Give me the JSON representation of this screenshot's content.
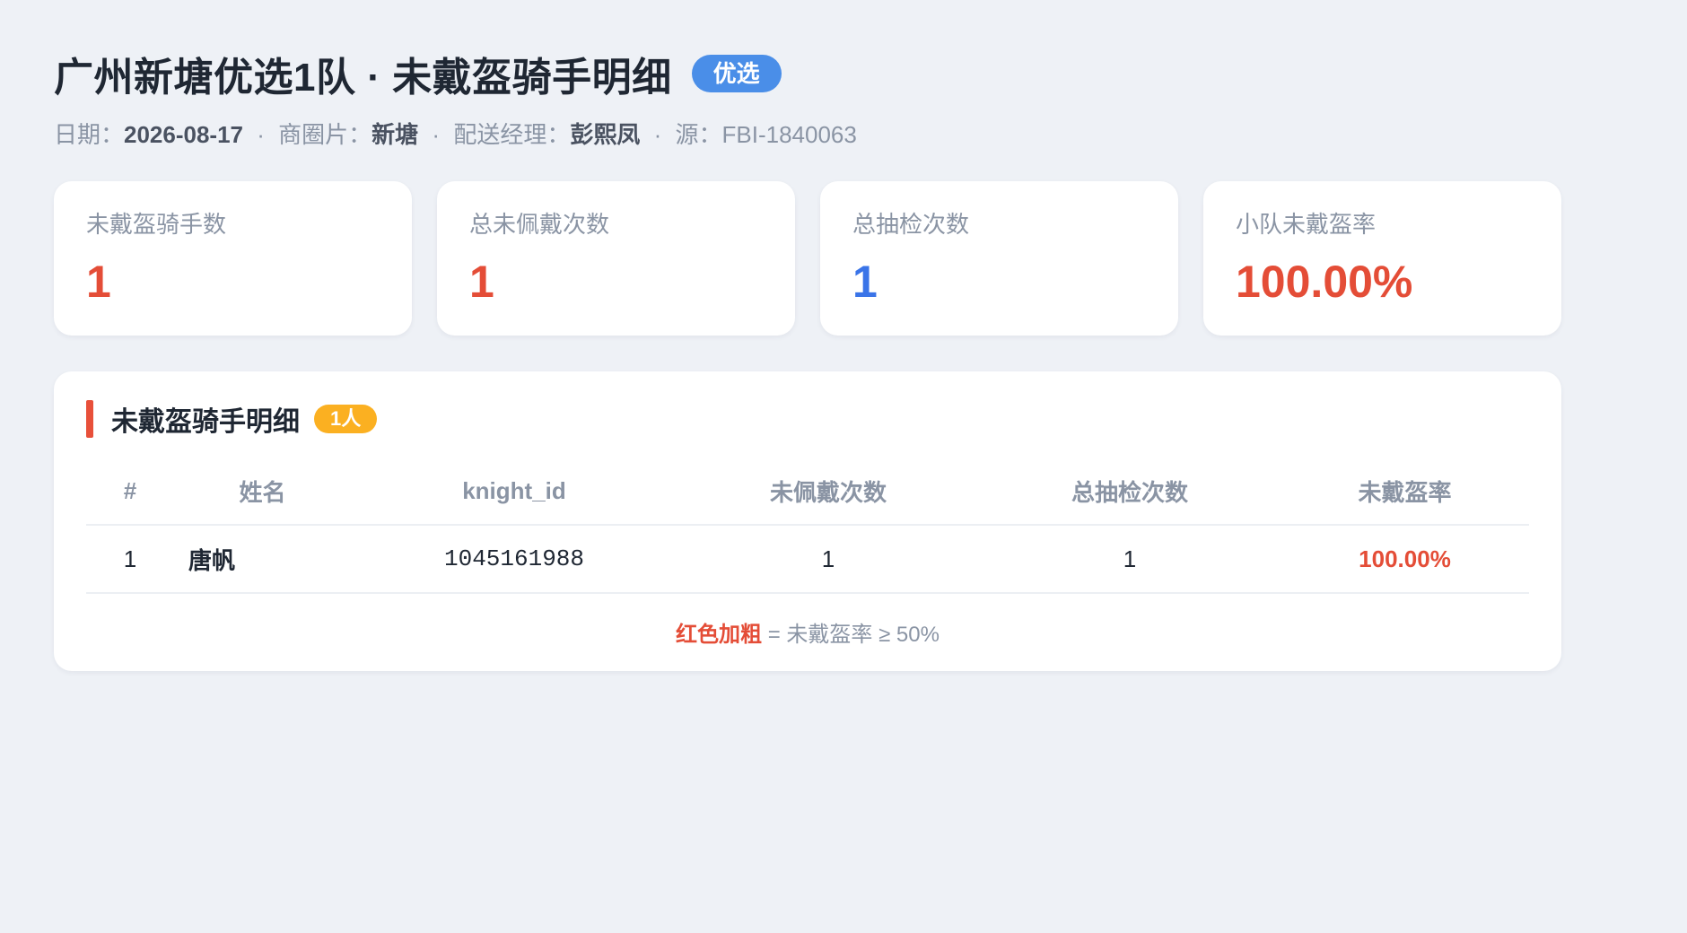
{
  "header": {
    "title": "广州新塘优选1队 · 未戴盔骑手明细",
    "badge": "优选",
    "meta": {
      "date_label": "日期：",
      "date": "2026-08-17",
      "area_label": "商圈片：",
      "area": "新塘",
      "manager_label": "配送经理：",
      "manager": "彭熙凤",
      "source_label": "源：",
      "source": "FBI-1840063",
      "separator": "·"
    }
  },
  "stats": [
    {
      "label": "未戴盔骑手数",
      "value": "1",
      "color": "#e44d37"
    },
    {
      "label": "总未佩戴次数",
      "value": "1",
      "color": "#e44d37"
    },
    {
      "label": "总抽检次数",
      "value": "1",
      "color": "#3a74e8"
    },
    {
      "label": "小队未戴盔率",
      "value": "100.00%",
      "color": "#e44d37"
    }
  ],
  "detail": {
    "section_title": "未戴盔骑手明细",
    "count_badge": "1人",
    "columns": [
      "#",
      "姓名",
      "knight_id",
      "未佩戴次数",
      "总抽检次数",
      "未戴盔率"
    ],
    "rows": [
      {
        "idx": "1",
        "name": "唐帆",
        "knight_id": "1045161988",
        "miss": "1",
        "checks": "1",
        "rate": "100.00%",
        "rate_color": "#e44d37"
      }
    ],
    "legend_key": "红色加粗",
    "legend_text": " = 未戴盔率 ≥ 50%",
    "legend_color": "#e44d37"
  }
}
